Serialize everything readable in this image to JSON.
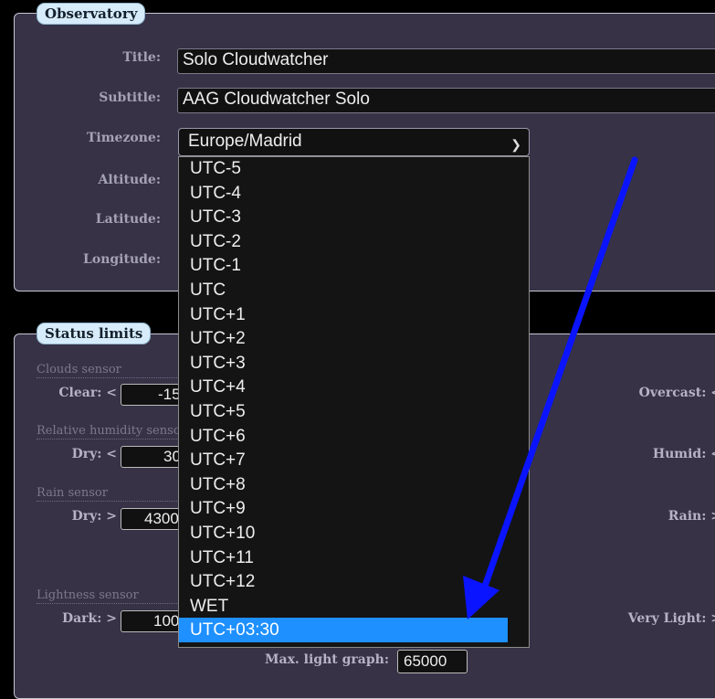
{
  "observatory": {
    "legend": "Observatory",
    "fields": {
      "title": {
        "label": "Title:",
        "value": "Solo Cloudwatcher"
      },
      "subtitle": {
        "label": "Subtitle:",
        "value": "AAG Cloudwatcher Solo"
      },
      "timezone": {
        "label": "Timezone:",
        "value": "Europe/Madrid"
      },
      "altitude": {
        "label": "Altitude:"
      },
      "latitude": {
        "label": "Latitude:"
      },
      "longitude": {
        "label": "Longitude:"
      }
    }
  },
  "timezone_options": [
    "UTC-5",
    "UTC-4",
    "UTC-3",
    "UTC-2",
    "UTC-1",
    "UTC",
    "UTC+1",
    "UTC+2",
    "UTC+3",
    "UTC+4",
    "UTC+5",
    "UTC+6",
    "UTC+7",
    "UTC+8",
    "UTC+9",
    "UTC+10",
    "UTC+11",
    "UTC+12",
    "WET",
    "UTC+03:30"
  ],
  "timezone_selected": "UTC+03:30",
  "status_limits": {
    "legend": "Status limits",
    "clouds": {
      "title": "Clouds sensor",
      "clear_label": "Clear: <",
      "clear_value": "-15",
      "overcast_label": "Overcast: <"
    },
    "humidity": {
      "title": "Relative humidity sensor",
      "dry_label": "Dry: <",
      "dry_value": "30",
      "humid_label": "Humid: <"
    },
    "rain": {
      "title": "Rain sensor",
      "dry_label": "Dry: >",
      "dry_value": "4300",
      "rain_label": "Rain: >"
    },
    "lightness": {
      "title": "Lightness sensor",
      "dark_label": "Dark: >",
      "dark_value": "100",
      "very_light_label": "Very Light: >",
      "max_graph_label": "Max. light graph:",
      "max_graph_value": "65000"
    }
  },
  "annotation": {
    "arrow_color": "#0a14ff"
  }
}
